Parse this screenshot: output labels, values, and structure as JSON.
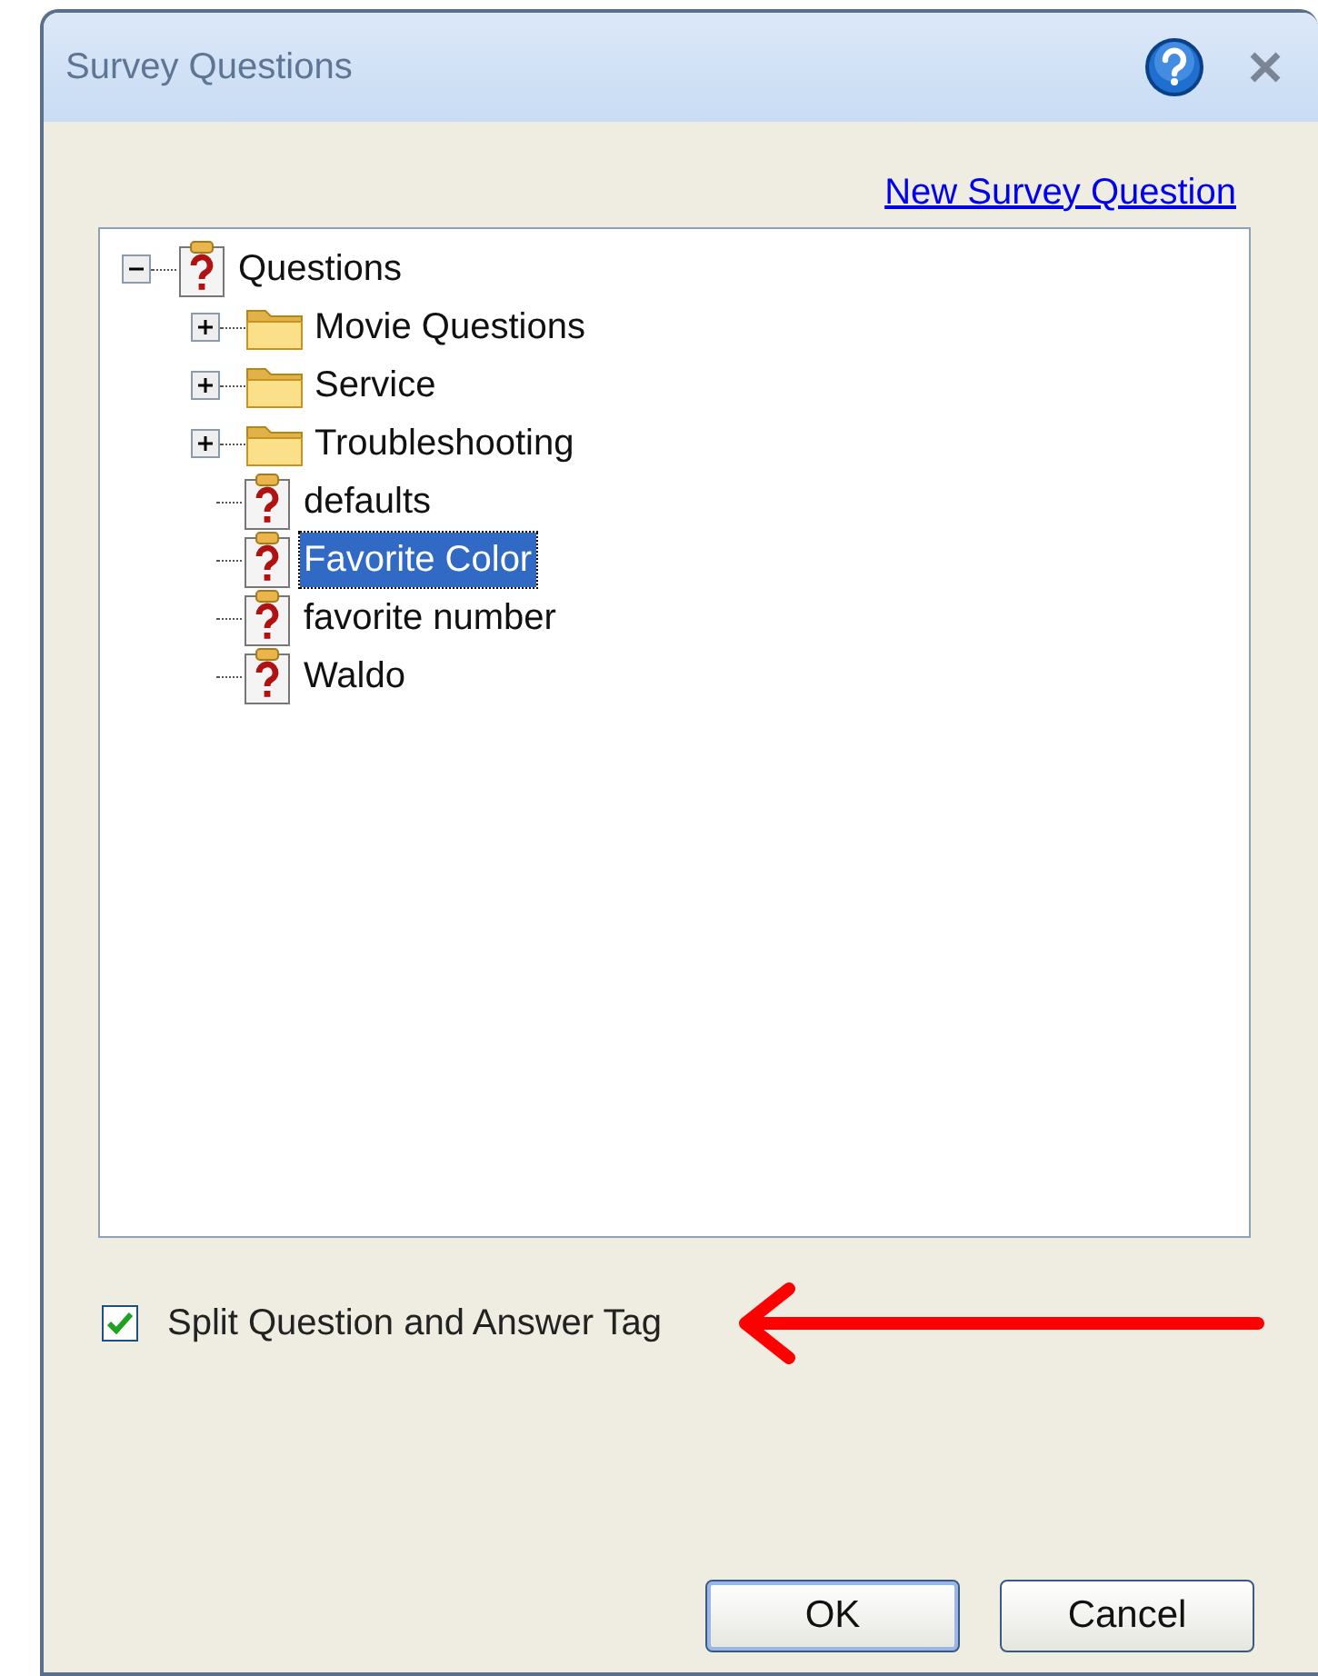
{
  "window": {
    "title": "Survey Questions"
  },
  "new_question_link": "New Survey Question",
  "tree": [
    {
      "label": "Questions",
      "kind": "question",
      "expanded": true,
      "selected": false,
      "children": [
        {
          "label": "Movie Questions",
          "kind": "folder",
          "expanded": false,
          "selected": false
        },
        {
          "label": "Service",
          "kind": "folder",
          "expanded": false,
          "selected": false
        },
        {
          "label": "Troubleshooting",
          "kind": "folder",
          "expanded": false,
          "selected": false
        },
        {
          "label": "defaults",
          "kind": "question",
          "selected": false
        },
        {
          "label": "Favorite Color",
          "kind": "question",
          "selected": true
        },
        {
          "label": "favorite number",
          "kind": "question",
          "selected": false
        },
        {
          "label": "Waldo",
          "kind": "question",
          "selected": false
        }
      ]
    }
  ],
  "split_option": {
    "label": "Split Question and Answer Tag",
    "checked": true
  },
  "buttons": [
    {
      "label": "OK",
      "default": true
    },
    {
      "label": "Cancel",
      "default": false
    }
  ]
}
